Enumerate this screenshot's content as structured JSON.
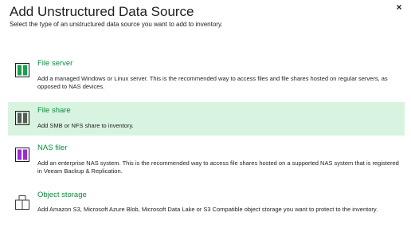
{
  "dialog": {
    "title": "Add Unstructured Data Source",
    "subtitle": "Select the type of an unstructured data source you want to add to inventory.",
    "close_icon": "×"
  },
  "options": [
    {
      "label": "File server",
      "description": "Add a managed Windows or Linux server. This is the recommended way to access files and file shares hosted on regular servers, as opposed to NAS devices.",
      "icon": "file-server-icon",
      "icon_color": "#16a34a"
    },
    {
      "label": "File share",
      "description": "Add SMB or NFS share to inventory.",
      "icon": "file-share-icon",
      "icon_color": "#5a5a5a",
      "selected": true
    },
    {
      "label": "NAS filer",
      "description": "Add an enterprise NAS system. This is the recommended way to access file shares hosted on a supported NAS system that is registered in Veeam Backup & Replication.",
      "icon": "nas-filer-icon",
      "icon_color": "#9b2bd6"
    },
    {
      "label": "Object storage",
      "description": "Add Amazon S3, Microsoft Azure Blob, Microsoft Data Lake or S3 Compatible object storage you want to protect to the inventory.",
      "icon": "object-storage-icon",
      "icon_color": "#3c3c3c"
    }
  ],
  "colors": {
    "accent": "#0b8a3d",
    "selected_background": "#d8f4e0"
  }
}
